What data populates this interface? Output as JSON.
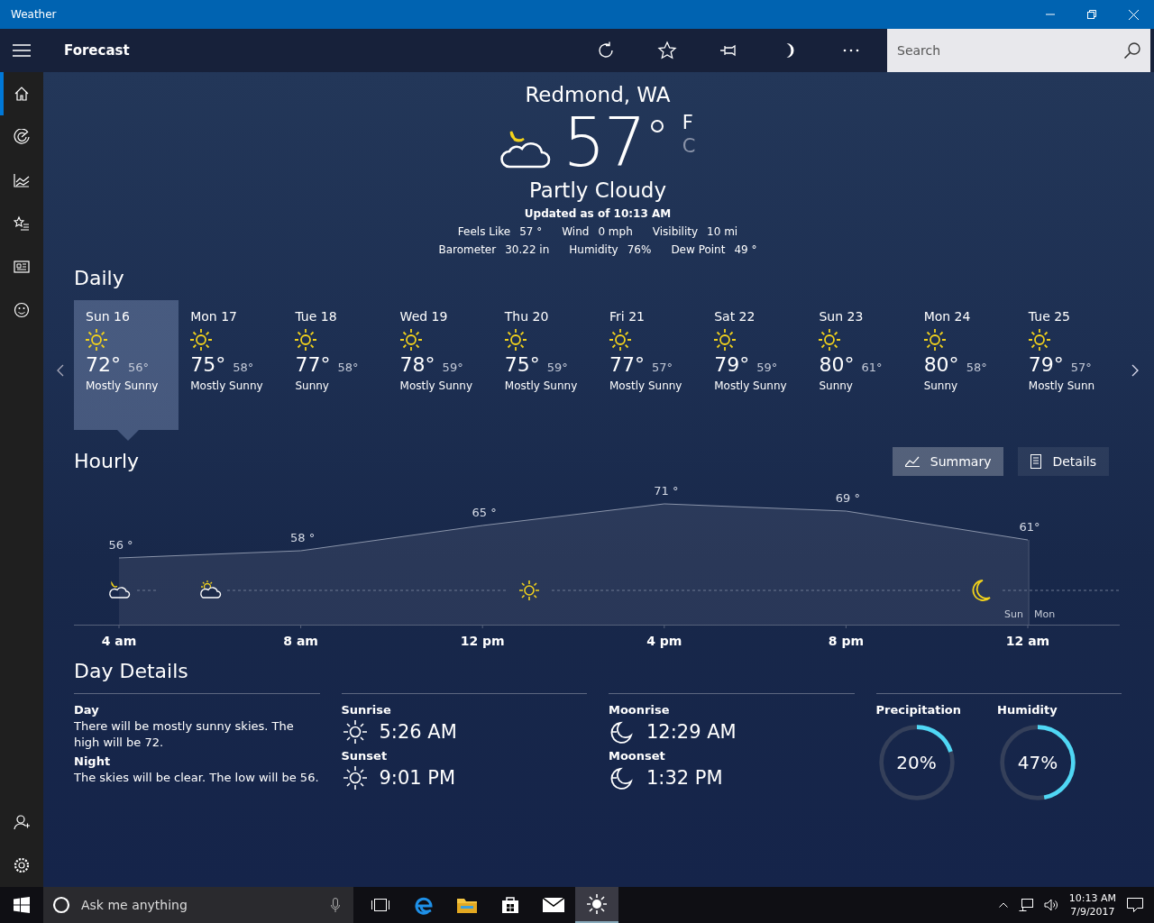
{
  "window": {
    "title": "Weather"
  },
  "app_bar": {
    "title": "Forecast",
    "search": {
      "placeholder": "Search"
    }
  },
  "nav": {
    "items": [
      {
        "selected": true
      },
      {
        "selected": false
      },
      {
        "selected": false
      },
      {
        "selected": false
      },
      {
        "selected": false
      },
      {
        "selected": false
      }
    ]
  },
  "current": {
    "location": "Redmond, WA",
    "temperature": "57",
    "units": [
      {
        "label": "F",
        "selected": true
      },
      {
        "label": "C",
        "selected": false
      }
    ],
    "condition": "Partly Cloudy",
    "updated": "Updated as of 10:13 AM",
    "stats": [
      [
        {
          "label": "Feels Like",
          "value": "57 °"
        },
        {
          "label": "Wind",
          "value": "0 mph"
        },
        {
          "label": "Visibility",
          "value": "10 mi"
        }
      ],
      [
        {
          "label": "Barometer",
          "value": "30.22 in"
        },
        {
          "label": "Humidity",
          "value": "76%"
        },
        {
          "label": "Dew Point",
          "value": "49 °"
        }
      ]
    ]
  },
  "daily": {
    "title": "Daily",
    "days": [
      {
        "day": "Sun 16",
        "high": "72°",
        "low": "56°",
        "desc": "Mostly Sunny",
        "selected": true
      },
      {
        "day": "Mon 17",
        "high": "75°",
        "low": "58°",
        "desc": "Mostly Sunny",
        "selected": false
      },
      {
        "day": "Tue 18",
        "high": "77°",
        "low": "58°",
        "desc": "Sunny",
        "selected": false
      },
      {
        "day": "Wed 19",
        "high": "78°",
        "low": "59°",
        "desc": "Mostly Sunny",
        "selected": false
      },
      {
        "day": "Thu 20",
        "high": "75°",
        "low": "59°",
        "desc": "Mostly Sunny",
        "selected": false
      },
      {
        "day": "Fri 21",
        "high": "77°",
        "low": "57°",
        "desc": "Mostly Sunny",
        "selected": false
      },
      {
        "day": "Sat 22",
        "high": "79°",
        "low": "59°",
        "desc": "Mostly Sunny",
        "selected": false
      },
      {
        "day": "Sun 23",
        "high": "80°",
        "low": "61°",
        "desc": "Sunny",
        "selected": false
      },
      {
        "day": "Mon 24",
        "high": "80°",
        "low": "58°",
        "desc": "Sunny",
        "selected": false
      },
      {
        "day": "Tue 25",
        "high": "79°",
        "low": "57°",
        "desc": "Mostly Sunn",
        "selected": false
      }
    ]
  },
  "hourly": {
    "title": "Hourly",
    "views": [
      {
        "label": "Summary",
        "selected": true
      },
      {
        "label": "Details",
        "selected": false
      }
    ],
    "day_labels": [
      "Sun",
      "Mon"
    ],
    "chart_data": {
      "type": "area",
      "x": [
        "4 am",
        "8 am",
        "12 pm",
        "4 pm",
        "8 pm",
        "12 am"
      ],
      "series": [
        {
          "color": "#8a94aa",
          "values": [
            56,
            58,
            65,
            71,
            69,
            61
          ],
          "value_labels": [
            "56 °",
            "58 °",
            "65 °",
            "71 °",
            "69 °",
            "61°"
          ]
        }
      ],
      "data_labels": true
    }
  },
  "day_details": {
    "title": "Day Details",
    "texts": [
      {
        "label": "Day",
        "text": "There will be mostly sunny skies. The high will be 72."
      },
      {
        "label": "Night",
        "text": "The skies will be clear. The low will be 56."
      }
    ],
    "sun": [
      {
        "label": "Sunrise",
        "time": "5:26 AM"
      },
      {
        "label": "Sunset",
        "time": "9:01 PM"
      }
    ],
    "moon": [
      {
        "label": "Moonrise",
        "time": "12:29 AM"
      },
      {
        "label": "Moonset",
        "time": "1:32 PM"
      }
    ],
    "rings": [
      {
        "label": "Precipitation",
        "value": "20%",
        "level": 0.2
      },
      {
        "label": "Humidity",
        "value": "47%",
        "level": 0.47
      }
    ]
  },
  "taskbar": {
    "search_placeholder": "Ask me anything",
    "time": "10:13 AM",
    "date": "7/9/2017"
  }
}
